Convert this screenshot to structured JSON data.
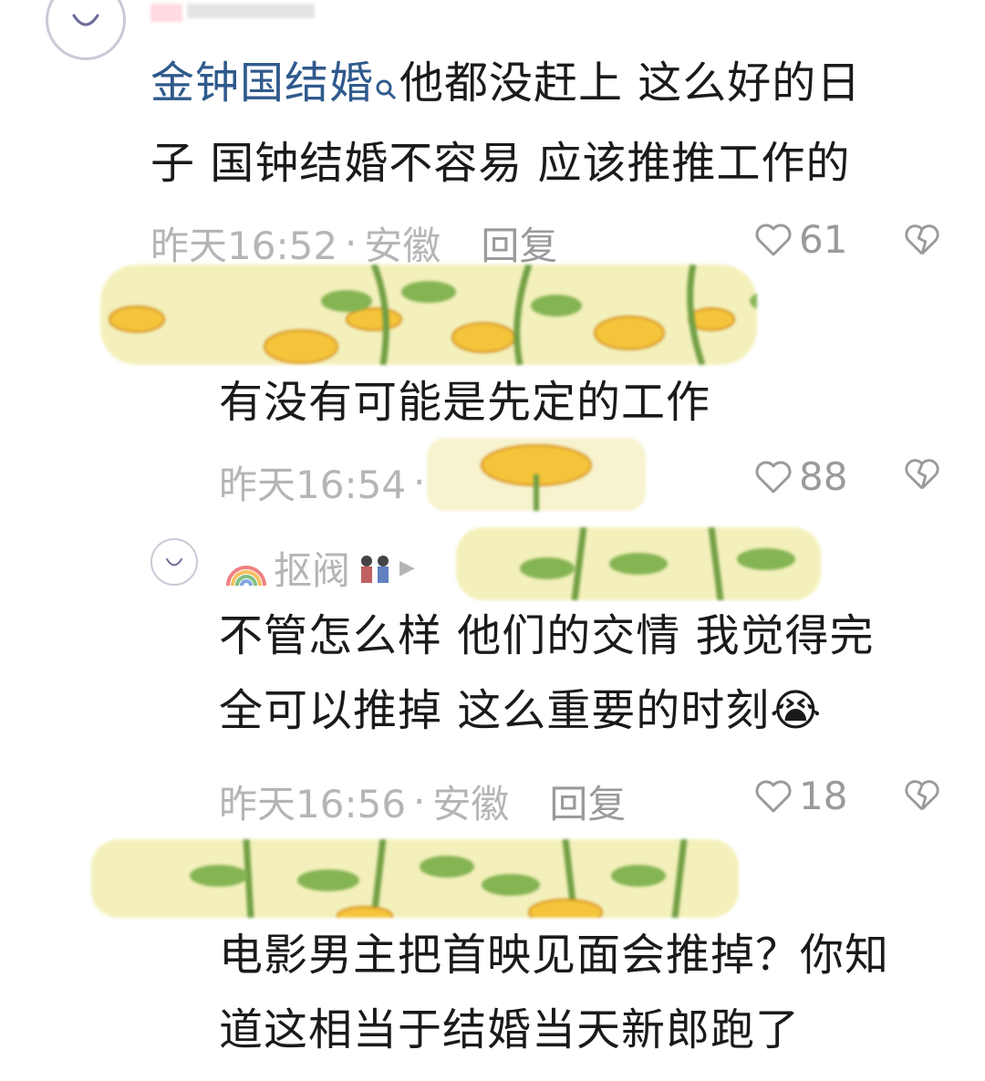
{
  "comments": [
    {
      "id": "c1",
      "avatar_icon": "smile-face-icon",
      "topic_link": "金钟国结婚",
      "search_icon": "search-icon",
      "text_after_link": "他都没赶上 这么好的日",
      "line2": "子 国钟结婚不容易 应该推推工作的",
      "time": "昨天16:52",
      "location": "安徽",
      "reply_label": "回复",
      "likes": "61"
    },
    {
      "id": "c2",
      "line1": "有没有可能是先定的工作",
      "time": "昨天16:54",
      "likes": "88"
    },
    {
      "id": "c3",
      "avatar_icon": "smile-face-icon",
      "username": "抠阀",
      "line1": "不管怎么样 他们的交情 我觉得完",
      "line2": "全可以推掉 这么重要的时刻",
      "emoji": "😭",
      "time": "昨天16:56",
      "location": "安徽",
      "reply_label": "回复",
      "likes": "18"
    },
    {
      "id": "c4",
      "line1": "电影男主把首映见面会推掉？你知",
      "line2": "道这相当于结婚当天新郎跑了"
    }
  ],
  "meta_separator": "·",
  "colors": {
    "link": "#2f5a8c",
    "meta": "#b5b5b5",
    "sunflower_bg": "#f3f0b8",
    "petal": "#f4c230",
    "stem": "#6a9a3a"
  }
}
